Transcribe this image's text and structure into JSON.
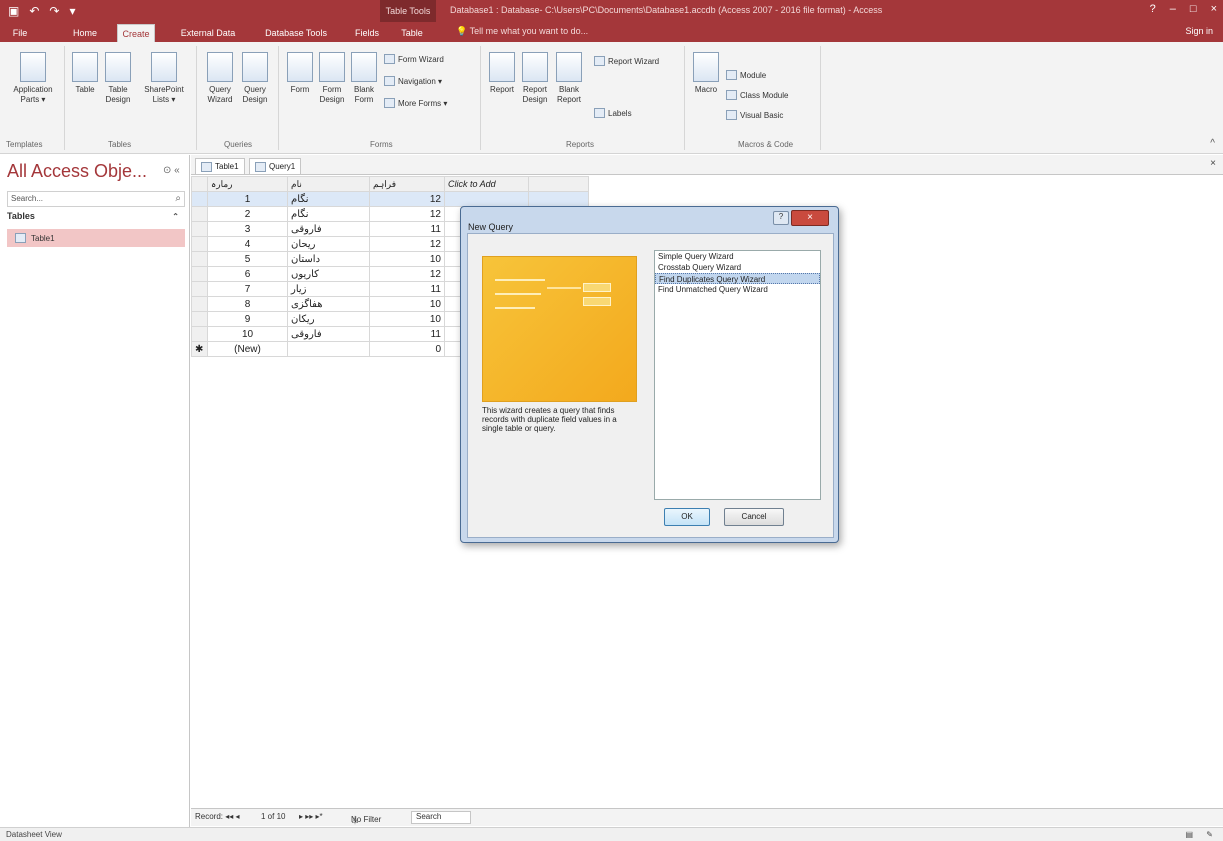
{
  "window": {
    "qat_icons": [
      "save-icon",
      "undo-icon",
      "redo-icon",
      "customize-icon"
    ],
    "tool_context": "Table Tools",
    "title": "Database1 : Database- C:\\Users\\PC\\Documents\\Database1.accdb (Access 2007 - 2016 file format) - Access",
    "controls": [
      "?",
      "–",
      "□",
      "×"
    ]
  },
  "tabs": {
    "file": "File",
    "home": "Home",
    "create": "Create",
    "external": "External Data",
    "dbtools": "Database Tools",
    "fields": "Fields",
    "table": "Table",
    "tellme": "Tell me what you want to do...",
    "signin": "Sign in"
  },
  "ribbon": {
    "app_parts": "Application\nParts ▾",
    "table": "Table",
    "table_design": "Table\nDesign",
    "sharepoint": "SharePoint\nLists ▾",
    "query_wizard": "Query\nWizard",
    "query_design": "Query\nDesign",
    "form": "Form",
    "form_design": "Form\nDesign",
    "blank_form": "Blank\nForm",
    "form_wizard": "Form Wizard",
    "navigation": "Navigation ▾",
    "more_forms": "More Forms ▾",
    "report": "Report",
    "report_design": "Report\nDesign",
    "blank_report": "Blank\nReport",
    "report_wizard": "Report Wizard",
    "labels": "Labels",
    "macro": "Macro",
    "module": "Module",
    "class_module": "Class Module",
    "visual_basic": "Visual Basic",
    "groups": {
      "templates": "Templates",
      "tables": "Tables",
      "queries": "Queries",
      "forms": "Forms",
      "reports": "Reports",
      "macros": "Macros & Code"
    }
  },
  "nav": {
    "title": "All Access Obje...",
    "search_placeholder": "Search...",
    "group": "Tables",
    "item": "Table1"
  },
  "doctabs": {
    "table1": "Table1",
    "query1": "Query1"
  },
  "sheet": {
    "headers": [
      "رمارہ",
      "نام",
      "فراہم",
      "Click to Add"
    ],
    "rows": [
      {
        "id": "1",
        "name": "نگام",
        "num": "12"
      },
      {
        "id": "2",
        "name": "نگام",
        "num": "12"
      },
      {
        "id": "3",
        "name": "فاروقی",
        "num": "11"
      },
      {
        "id": "4",
        "name": "ریحان",
        "num": "12"
      },
      {
        "id": "5",
        "name": "داستان",
        "num": "10"
      },
      {
        "id": "6",
        "name": "کاریوں",
        "num": "12"
      },
      {
        "id": "7",
        "name": "زیار",
        "num": "11"
      },
      {
        "id": "8",
        "name": "هفاگزی",
        "num": "10"
      },
      {
        "id": "9",
        "name": "ریکان",
        "num": "10"
      },
      {
        "id": "10",
        "name": "فاروقی",
        "num": "11"
      }
    ],
    "new_row": {
      "id": "(New)",
      "num": "0"
    }
  },
  "recnav": {
    "label": "Record: ◂◂ ◂",
    "position": "1 of 10",
    "next": "▸ ▸▸ ▸*",
    "filter": "No Filter",
    "search": "Search"
  },
  "status": {
    "view": "Datasheet View"
  },
  "dialog": {
    "title": "New Query",
    "help": "?",
    "close": "×",
    "options": [
      "Simple Query Wizard",
      "Crosstab Query Wizard",
      "Find Duplicates Query Wizard",
      "Find Unmatched Query Wizard"
    ],
    "selected_index": 2,
    "description": "This wizard creates a query that finds records with duplicate field values in a single table or query.",
    "ok": "OK",
    "cancel": "Cancel"
  },
  "colors": {
    "accent": "#a4373a",
    "selection": "#f2c6c6",
    "wizard": "#f3a91d"
  }
}
